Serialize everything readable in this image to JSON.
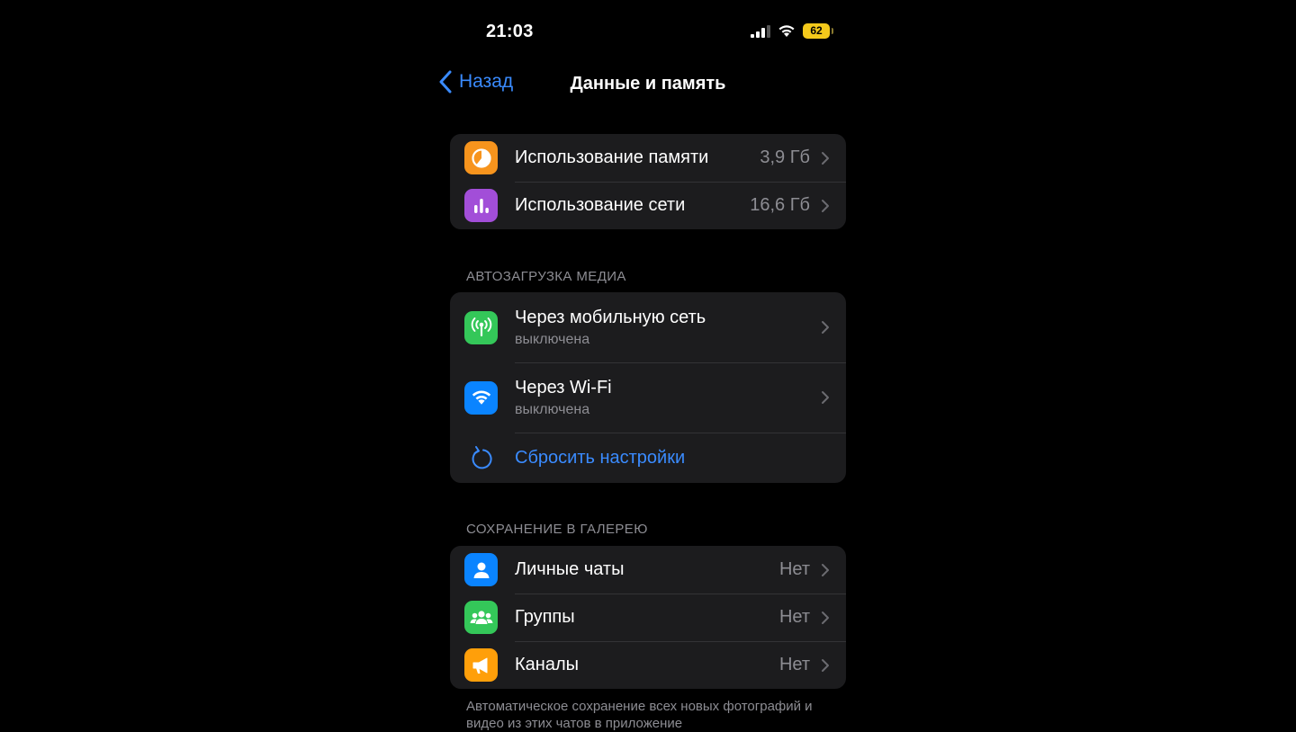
{
  "status_bar": {
    "time": "21:03",
    "battery": "62"
  },
  "nav": {
    "back_label": "Назад",
    "title": "Данные и память"
  },
  "usage": {
    "items": [
      {
        "label": "Использование памяти",
        "value": "3,9 Гб",
        "icon": "pie-chart-icon",
        "color": "#f7941d"
      },
      {
        "label": "Использование сети",
        "value": "16,6 Гб",
        "icon": "bar-chart-icon",
        "color": "#a24ed8"
      }
    ]
  },
  "autodownload": {
    "header": "АВТОЗАГРУЗКА МЕДИА",
    "items": [
      {
        "label": "Через мобильную сеть",
        "sub": "выключена",
        "icon": "antenna-icon",
        "color": "#34c759"
      },
      {
        "label": "Через Wi-Fi",
        "sub": "выключена",
        "icon": "wifi-icon",
        "color": "#0a84ff"
      }
    ],
    "reset_label": "Сбросить настройки"
  },
  "gallery": {
    "header": "СОХРАНЕНИЕ В ГАЛЕРЕЮ",
    "items": [
      {
        "label": "Личные чаты",
        "value": "Нет",
        "icon": "person-icon",
        "color": "#0a84ff"
      },
      {
        "label": "Группы",
        "value": "Нет",
        "icon": "group-icon",
        "color": "#34c759"
      },
      {
        "label": "Каналы",
        "value": "Нет",
        "icon": "megaphone-icon",
        "color": "#ff9f0a"
      }
    ],
    "footer": "Автоматическое сохранение всех новых фотографий и видео из этих чатов в приложение"
  }
}
